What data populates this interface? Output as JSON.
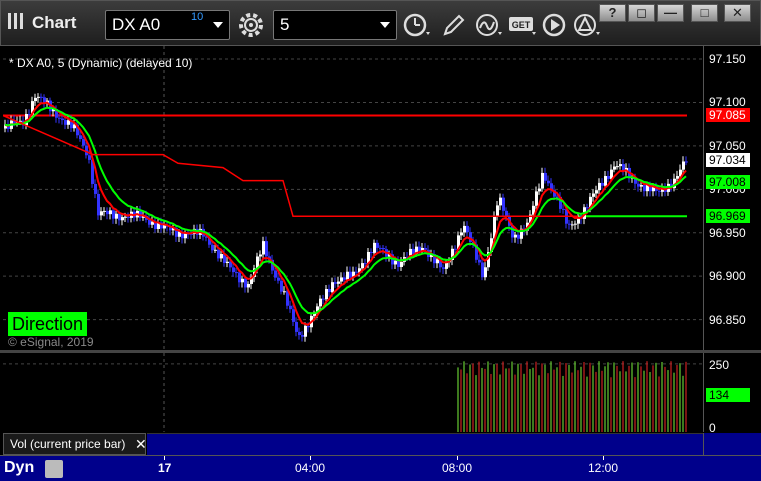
{
  "toolbar": {
    "title": "Chart",
    "symbol": "DX A0",
    "symbol_superscript": "10",
    "interval": "5",
    "window_buttons": [
      "?",
      "◻",
      "—",
      "□",
      "✕"
    ],
    "get_label": "GET"
  },
  "chart": {
    "caption": "* DX A0, 5 (Dynamic) (delayed 10)",
    "direction_label": "Direction",
    "copyright": "© eSignal, 2019",
    "price_ticks": [
      "97.150",
      "97.100",
      "97.050",
      "97.000",
      "96.950",
      "96.900",
      "96.850"
    ],
    "price_tags": [
      {
        "value": "97.085",
        "bg": "#ff0000",
        "fg": "#ffffff",
        "price": 97.085
      },
      {
        "value": "97.034",
        "bg": "#ffffff",
        "fg": "#000000",
        "price": 97.034
      },
      {
        "value": "97.008",
        "bg": "#00ff00",
        "fg": "#000000",
        "price": 97.008
      },
      {
        "value": "96.969",
        "bg": "#00ff00",
        "fg": "#000000",
        "price": 96.969
      }
    ],
    "price_range": [
      96.815,
      97.165
    ],
    "horizontal_lines": [
      {
        "price": 97.085,
        "color": "#ff0000"
      },
      {
        "price": 96.969,
        "color": "#00ff00"
      }
    ]
  },
  "volume": {
    "legend": "Vol (current price bar)",
    "close_glyph": "✕",
    "ticks": [
      "250",
      "0"
    ],
    "current_tag": "134",
    "range": [
      0,
      290
    ]
  },
  "time_axis": {
    "mode_label": "Dyn",
    "labels": [
      {
        "text": "17",
        "bold": true
      },
      {
        "text": "04:00",
        "bold": false
      },
      {
        "text": "08:00",
        "bold": false
      },
      {
        "text": "12:00",
        "bold": false
      }
    ]
  },
  "colors": {
    "up_bar": "#ffffff",
    "down_bar": "#3333ff",
    "ma_fast": "#ff0000",
    "ma_slow": "#00ff00",
    "vol_up": "#66cc33",
    "vol_down": "#cc2222"
  }
}
